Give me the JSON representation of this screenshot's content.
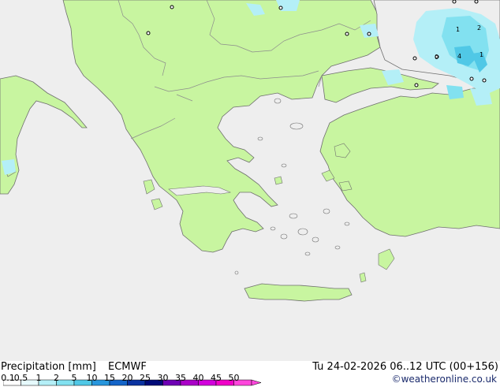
{
  "footer": {
    "title": "Precipitation [mm]",
    "model": "ECMWF",
    "validity": "Tu 24-02-2026 06..12 UTC (00+156)",
    "credit": "©weatheronline.co.uk"
  },
  "legend": {
    "ticks": [
      "0.1",
      "0.5",
      "1",
      "2",
      "5",
      "10",
      "15",
      "20",
      "25",
      "30",
      "35",
      "40",
      "45",
      "50"
    ],
    "colors": [
      "#ffffff",
      "#e6fafd",
      "#b4eff7",
      "#82e1f0",
      "#50c8e6",
      "#2896dc",
      "#1464c8",
      "#0a32a0",
      "#000a78",
      "#6e00b4",
      "#aa00c8",
      "#d200dc",
      "#f000c8",
      "#ff46dc"
    ]
  },
  "map": {
    "colors": {
      "sea": "#eeeeee",
      "land": "#c8f5a0",
      "border": "#8c8c8c",
      "coast": "#6e6e6e"
    },
    "precip_labels": [
      "1",
      "2",
      "4",
      "1",
      "0"
    ]
  }
}
